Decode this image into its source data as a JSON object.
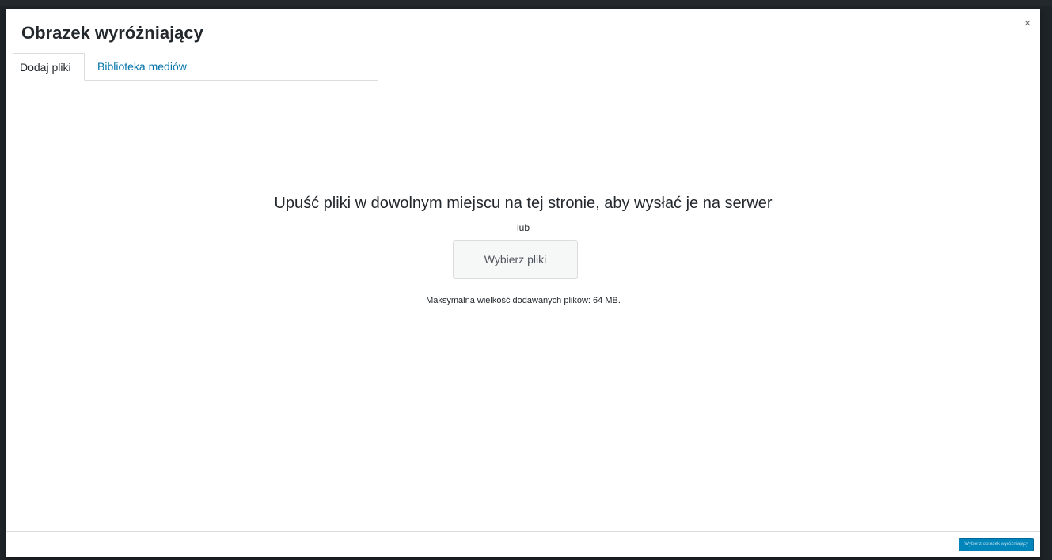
{
  "modal": {
    "title": "Obrazek wyróżniający",
    "close_label": "×"
  },
  "tabs": [
    {
      "label": "Dodaj pliki",
      "active": true
    },
    {
      "label": "Biblioteka mediów",
      "active": false
    }
  ],
  "uploader": {
    "instructions": "Upuść pliki w dowolnym miejscu na tej stronie, aby wysłać je na serwer",
    "or_text": "lub",
    "select_button_label": "Wybierz pliki",
    "max_size_text": "Maksymalna wielkość dodawanych plików: 64 MB."
  },
  "toolbar": {
    "primary_button_label": "Wybierz obrazek wyróżniający"
  },
  "colors": {
    "accent": "#0073aa",
    "primary_button": "#0085ba",
    "backdrop": "#1d2327"
  }
}
